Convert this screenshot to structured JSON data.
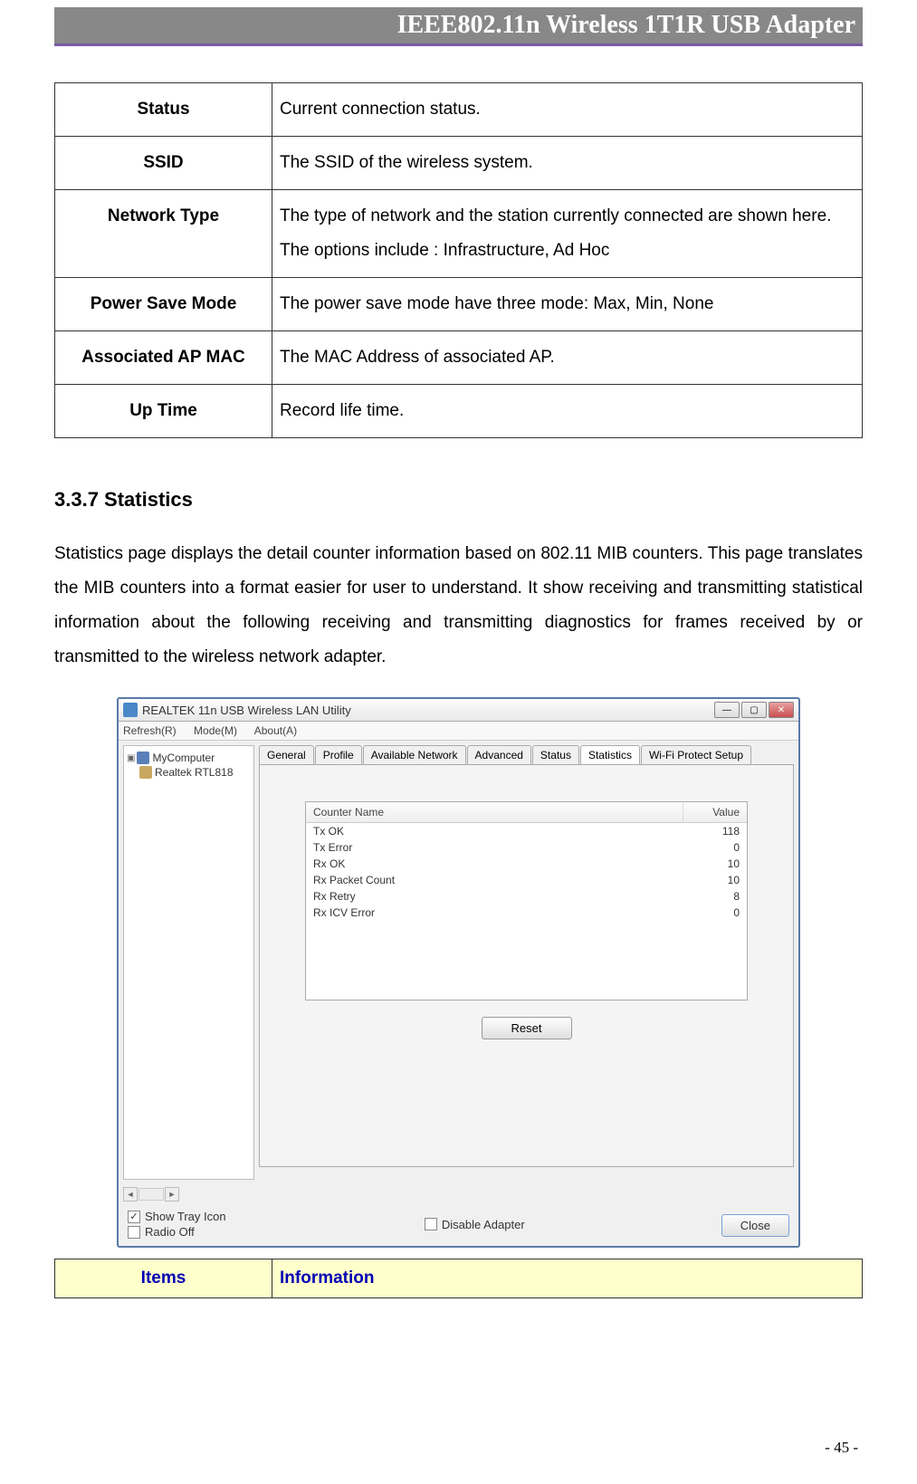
{
  "header": "IEEE802.11n Wireless 1T1R USB Adapter",
  "defs": [
    {
      "label": "Status",
      "desc": "Current connection status."
    },
    {
      "label": "SSID",
      "desc": "The SSID of the wireless system."
    },
    {
      "label": "Network Type",
      "desc": "The type of network and the station currently connected are shown here. The options include : Infrastructure, Ad Hoc"
    },
    {
      "label": "Power Save Mode",
      "desc": "The power save mode have three mode: Max, Min, None"
    },
    {
      "label": "Associated AP MAC",
      "desc": "The MAC Address of associated AP."
    },
    {
      "label": "Up Time",
      "desc": "Record life time."
    }
  ],
  "section_heading": "3.3.7    Statistics",
  "body_text": "Statistics page displays the detail counter information based on 802.11 MIB counters. This page translates the MIB counters into a format easier for user to understand. It show receiving and transmitting statistical information about the following receiving and transmitting diagnostics for frames received by or transmitted to the wireless network adapter.",
  "app": {
    "title": "REALTEK 11n USB Wireless LAN Utility",
    "menus": [
      "Refresh(R)",
      "Mode(M)",
      "About(A)"
    ],
    "tree": {
      "root": "MyComputer",
      "child": "Realtek RTL818"
    },
    "tabs": [
      "General",
      "Profile",
      "Available Network",
      "Advanced",
      "Status",
      "Statistics",
      "Wi-Fi Protect Setup"
    ],
    "active_tab_index": 5,
    "stats_header": {
      "name": "Counter Name",
      "value": "Value"
    },
    "stats": [
      {
        "name": "Tx OK",
        "value": "118"
      },
      {
        "name": "Tx Error",
        "value": "0"
      },
      {
        "name": "Rx OK",
        "value": "10"
      },
      {
        "name": "Rx Packet Count",
        "value": "10"
      },
      {
        "name": "Rx Retry",
        "value": "8"
      },
      {
        "name": "Rx ICV Error",
        "value": "0"
      }
    ],
    "reset": "Reset",
    "checkboxes": {
      "show_tray": {
        "label": "Show Tray Icon",
        "checked": true
      },
      "radio_off": {
        "label": "Radio Off",
        "checked": false
      },
      "disable_adapter": {
        "label": "Disable Adapter",
        "checked": false
      }
    },
    "close": "Close"
  },
  "items_row": {
    "label": "Items",
    "info": "Information"
  },
  "page_number": "- 45 -"
}
